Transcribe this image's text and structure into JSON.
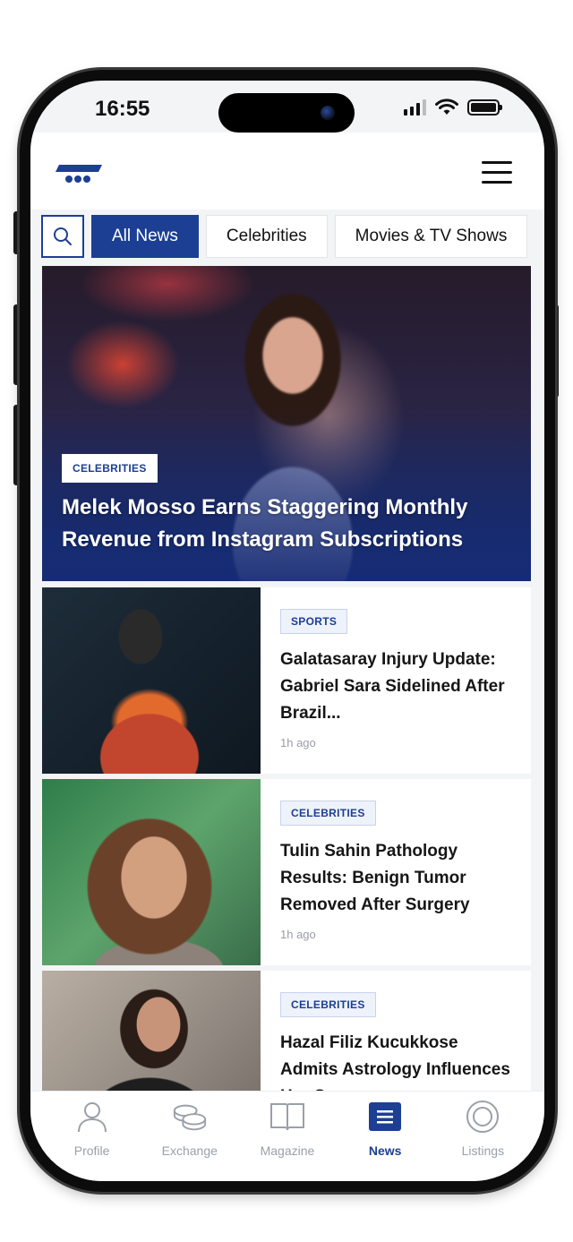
{
  "status_bar": {
    "time": "16:55"
  },
  "tabs": {
    "items": [
      {
        "label": "All News",
        "active": true
      },
      {
        "label": "Celebrities",
        "active": false
      },
      {
        "label": "Movies & TV Shows",
        "active": false
      }
    ]
  },
  "hero": {
    "category": "CELEBRITIES",
    "title": "Melek Mosso Earns Staggering Monthly Revenue from Instagram Subscriptions"
  },
  "articles": [
    {
      "category": "SPORTS",
      "title": "Galatasaray Injury Update: Gabriel Sara Sidelined After Brazil...",
      "time": "1h ago"
    },
    {
      "category": "CELEBRITIES",
      "title": "Tulin Sahin Pathology Results: Benign Tumor Removed After Surgery",
      "time": "1h ago"
    },
    {
      "category": "CELEBRITIES",
      "title": "Hazal Filiz Kucukkose Admits Astrology Influences Her Career",
      "time": ""
    }
  ],
  "bottom_nav": {
    "items": [
      {
        "label": "Profile",
        "icon": "person-icon",
        "active": false
      },
      {
        "label": "Exchange",
        "icon": "coins-icon",
        "active": false
      },
      {
        "label": "Magazine",
        "icon": "book-icon",
        "active": false
      },
      {
        "label": "News",
        "icon": "news-list-icon",
        "active": true
      },
      {
        "label": "Listings",
        "icon": "target-icon",
        "active": false
      }
    ]
  },
  "colors": {
    "accent": "#1c3f94",
    "inactive": "#9aa0a8"
  }
}
